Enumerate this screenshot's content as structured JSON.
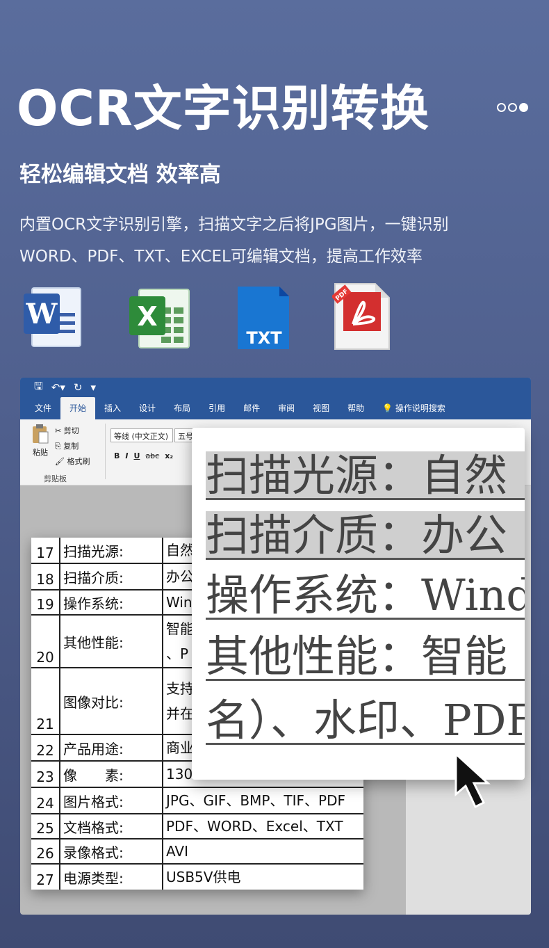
{
  "header": {
    "title": "OCR文字识别转换",
    "subtitle": "轻松编辑文档 效率高",
    "description_lines": [
      "内置OCR文字识别引擎，扫描文字之后将JPG图片，一键识别",
      "WORD、PDF、TXT、EXCEL可编辑文档，提高工作效率"
    ]
  },
  "format_icons": {
    "word_letter": "W",
    "excel_letter": "X",
    "txt_label": "TXT",
    "pdf_label": "PDF"
  },
  "word_app": {
    "menu": [
      "文件",
      "开始",
      "插入",
      "设计",
      "布局",
      "引用",
      "邮件",
      "审阅",
      "视图",
      "帮助"
    ],
    "search": "操作说明搜索",
    "paste": "粘贴",
    "cut": "剪切",
    "copy": "复制",
    "format_painter": "格式刷",
    "clipboard": "剪贴板",
    "font_name": "等线 (中文正文)",
    "font_size": "五号",
    "format_buttons": [
      "B",
      "I",
      "U",
      "abc",
      "x₂"
    ]
  },
  "sheet_rows": [
    {
      "num": "17",
      "label": "扫描光源:",
      "value": "自然"
    },
    {
      "num": "18",
      "label": "扫描介质:",
      "value": "办公"
    },
    {
      "num": "19",
      "label": "操作系统:",
      "value": "Win"
    },
    {
      "num": "20",
      "label": "其他性能:",
      "value": "智能",
      "value2": "、P"
    },
    {
      "num": "21",
      "label": "图像对比:",
      "value": "支持",
      "value2": "并在"
    },
    {
      "num": "22",
      "label": "产品用途:",
      "value": "商业"
    },
    {
      "num": "23",
      "label": "像　　素:",
      "value": "130"
    },
    {
      "num": "24",
      "label": "图片格式:",
      "value": "JPG、GIF、BMP、TIF、PDF"
    },
    {
      "num": "25",
      "label": "文档格式:",
      "value": "PDF、WORD、Excel、TXT"
    },
    {
      "num": "26",
      "label": "录像格式:",
      "value": "AVI"
    },
    {
      "num": "27",
      "label": "电源类型:",
      "value": "USB5V供电"
    }
  ],
  "zoom_lines": [
    "扫描光源：自然",
    "扫描介质：办公",
    "操作系统：Wind",
    "其他性能：智能",
    "名）、水印、PDF"
  ],
  "colors": {
    "word_blue": "#2b579a",
    "excel_green": "#2e7d32",
    "txt_blue": "#1565c0",
    "pdf_red": "#d32f2f"
  }
}
